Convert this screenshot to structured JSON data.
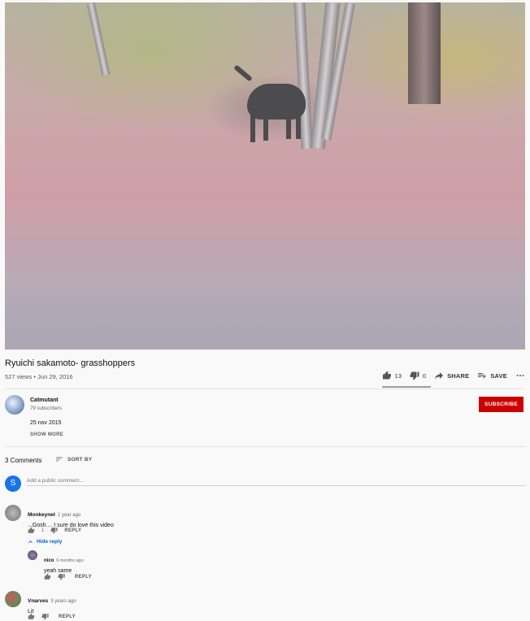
{
  "video": {
    "title": "Ryuichi sakamoto- grasshoppers",
    "views_date": "527 views • Jun 29, 2016"
  },
  "actions": {
    "like_count": "13",
    "dislike_count": "0",
    "share_label": "SHARE",
    "save_label": "SAVE",
    "more_icon": "more-horiz-icon"
  },
  "channel": {
    "name": "Catmutant",
    "subscribers": "79 subscribers",
    "subscribe_label": "SUBSCRIBE"
  },
  "description": {
    "text": "25 nov 2015",
    "show_more": "SHOW MORE"
  },
  "comments_header": {
    "count": "3 Comments",
    "sort_label": "SORT BY"
  },
  "add_comment": {
    "avatar_letter": "S",
    "placeholder": "Add a public comment..."
  },
  "comments": [
    {
      "author": "Monkeynet",
      "time": "1 year ago",
      "text": "...Gosh.... I sure do love this video",
      "likes": "1",
      "reply_label": "REPLY",
      "avatar_color": "#8a8a8a"
    },
    {
      "author": "nico",
      "time": "6 months ago",
      "text": "yeah same",
      "likes": "",
      "reply_label": "REPLY",
      "avatar_color": "#6b5a7a"
    },
    {
      "author": "Vnarves",
      "time": "3 years ago",
      "text": "Lit",
      "likes": "",
      "reply_label": "REPLY",
      "avatar_color": "#7a9a6a"
    }
  ],
  "hide_reply_label": "Hide reply",
  "colors": {
    "subscribe": "#cc0000",
    "link_blue": "#065fd4",
    "my_avatar": "#1a73e8"
  }
}
